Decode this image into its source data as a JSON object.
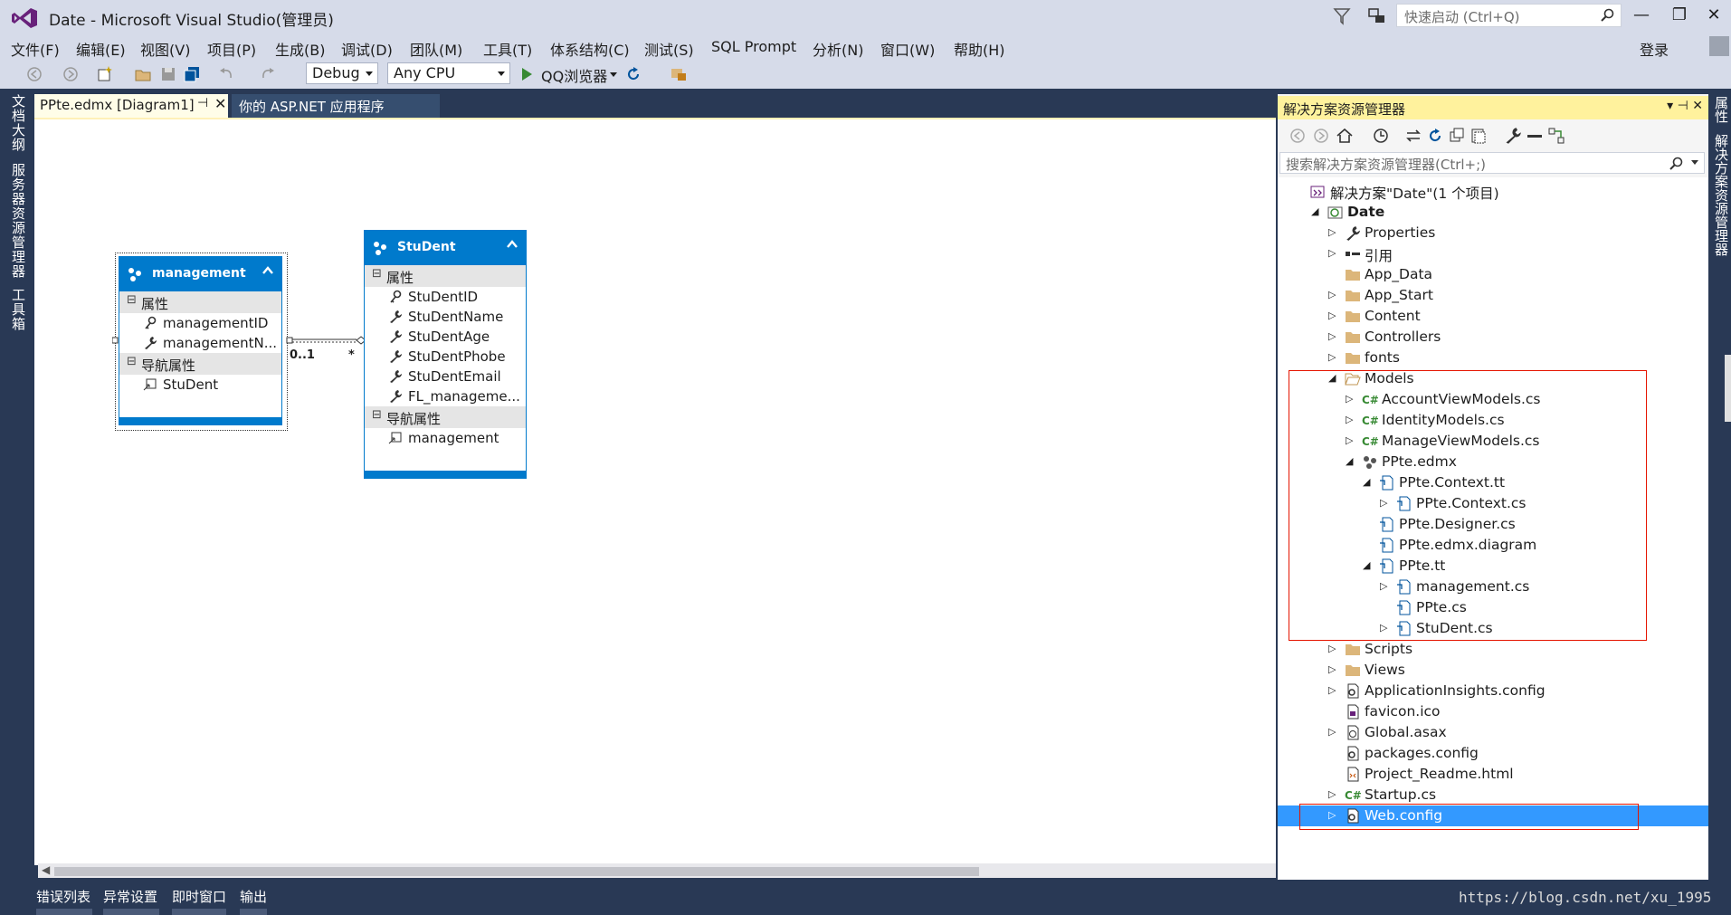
{
  "window": {
    "title": "Date - Microsoft Visual Studio(管理员)",
    "quick_launch_placeholder": "快速启动 (Ctrl+Q)",
    "controls": [
      "—",
      "❐",
      "✕"
    ]
  },
  "menu": [
    "文件(F)",
    "编辑(E)",
    "视图(V)",
    "项目(P)",
    "生成(B)",
    "调试(D)",
    "团队(M)",
    "工具(T)",
    "体系结构(C)",
    "测试(S)",
    "SQL Prompt",
    "分析(N)",
    "窗口(W)",
    "帮助(H)"
  ],
  "login_label": "登录",
  "toolbar": {
    "config": "Debug",
    "platform": "Any CPU",
    "run_label": "QQ浏览器"
  },
  "left_tabs": [
    "文档大纲",
    "服务器资源管理器",
    "工具箱"
  ],
  "doc_tabs": {
    "active": "PPte.edmx [Diagram1]",
    "pin": "⊣",
    "close": "✕",
    "inactive": "你的 ASP.NET 应用程序"
  },
  "diagram": {
    "management": {
      "title": "management",
      "section_props": "属性",
      "props": [
        "managementID",
        "managementN..."
      ],
      "section_nav": "导航属性",
      "nav": [
        "StuDent"
      ]
    },
    "student": {
      "title": "StuDent",
      "section_props": "属性",
      "props": [
        "StuDentID",
        "StuDentName",
        "StuDentAge",
        "StuDentPhobe",
        "StuDentEmail",
        "FL_manageme..."
      ],
      "section_nav": "导航属性",
      "nav": [
        "management"
      ]
    },
    "association": {
      "left_mult": "0..1",
      "right_mult": "*"
    }
  },
  "solution_explorer": {
    "title": "解决方案资源管理器",
    "header_buttons": "▾ ⊣ ✕",
    "search_placeholder": "搜索解决方案资源管理器(Ctrl+;)",
    "tree": [
      {
        "label": "解决方案\"Date\"(1 个项目)",
        "icon": "solution-icon",
        "arrow": ""
      },
      {
        "label": "Date",
        "icon": "project-icon",
        "arrow": "open",
        "bold": true
      },
      {
        "label": "Properties",
        "icon": "wrench-icon",
        "arrow": "closed"
      },
      {
        "label": "引用",
        "icon": "references-icon",
        "arrow": "closed"
      },
      {
        "label": "App_Data",
        "icon": "folder-icon",
        "arrow": ""
      },
      {
        "label": "App_Start",
        "icon": "folder-icon",
        "arrow": "closed"
      },
      {
        "label": "Content",
        "icon": "folder-icon",
        "arrow": "closed"
      },
      {
        "label": "Controllers",
        "icon": "folder-icon",
        "arrow": "closed"
      },
      {
        "label": "fonts",
        "icon": "folder-icon",
        "arrow": "closed"
      },
      {
        "label": "Models",
        "icon": "folder-open-icon",
        "arrow": "open"
      },
      {
        "label": "AccountViewModels.cs",
        "icon": "csharp-icon",
        "arrow": "closed"
      },
      {
        "label": "IdentityModels.cs",
        "icon": "csharp-icon",
        "arrow": "closed"
      },
      {
        "label": "ManageViewModels.cs",
        "icon": "csharp-icon",
        "arrow": "closed"
      },
      {
        "label": "PPte.edmx",
        "icon": "edmx-icon",
        "arrow": "open"
      },
      {
        "label": "PPte.Context.tt",
        "icon": "file-icon",
        "arrow": "open"
      },
      {
        "label": "PPte.Context.cs",
        "icon": "file-icon",
        "arrow": "closed"
      },
      {
        "label": "PPte.Designer.cs",
        "icon": "file-icon",
        "arrow": ""
      },
      {
        "label": "PPte.edmx.diagram",
        "icon": "file-icon",
        "arrow": ""
      },
      {
        "label": "PPte.tt",
        "icon": "file-icon",
        "arrow": "open"
      },
      {
        "label": "management.cs",
        "icon": "file-icon",
        "arrow": "closed"
      },
      {
        "label": "PPte.cs",
        "icon": "file-icon",
        "arrow": ""
      },
      {
        "label": "StuDent.cs",
        "icon": "file-icon",
        "arrow": "closed"
      },
      {
        "label": "Scripts",
        "icon": "folder-icon",
        "arrow": "closed"
      },
      {
        "label": "Views",
        "icon": "folder-icon",
        "arrow": "closed"
      },
      {
        "label": "ApplicationInsights.config",
        "icon": "config-icon",
        "arrow": "closed"
      },
      {
        "label": "favicon.ico",
        "icon": "image-file-icon",
        "arrow": ""
      },
      {
        "label": "Global.asax",
        "icon": "asax-icon",
        "arrow": "closed"
      },
      {
        "label": "packages.config",
        "icon": "config-icon",
        "arrow": ""
      },
      {
        "label": "Project_Readme.html",
        "icon": "html-file-icon",
        "arrow": ""
      },
      {
        "label": "Startup.cs",
        "icon": "csharp-icon",
        "arrow": "closed"
      },
      {
        "label": "Web.config",
        "icon": "config-icon",
        "arrow": "closed",
        "selected": true
      }
    ]
  },
  "right_tabs": [
    "属性",
    "解决方案资源管理器"
  ],
  "bottom_tabs": [
    "错误列表",
    "异常设置",
    "即时窗口",
    "输出"
  ],
  "watermark": "https://blog.csdn.net/xu_1995",
  "colors": {
    "accent": "#007acc",
    "selection": "#3399ff",
    "chrome": "#d6dbe9",
    "frame": "#293955",
    "highlight": "#e51400"
  }
}
